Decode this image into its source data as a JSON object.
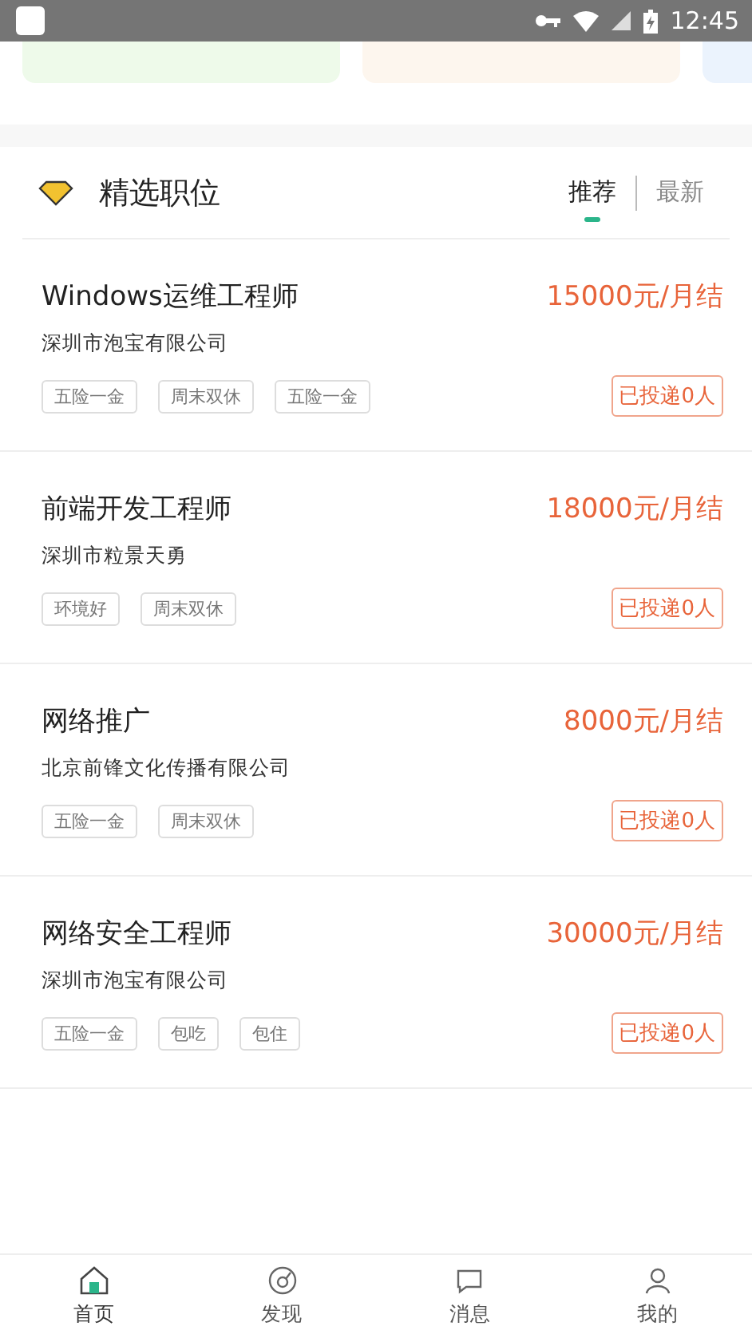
{
  "status_bar": {
    "time": "12:45"
  },
  "section": {
    "title": "精选职位",
    "tabs": [
      {
        "label": "推荐",
        "selected": true
      },
      {
        "label": "最新",
        "selected": false
      }
    ]
  },
  "jobs": [
    {
      "title": "Windows运维工程师",
      "salary": "15000元/月结",
      "company": "深圳市泡宝有限公司",
      "tags": [
        "五险一金",
        "周末双休",
        "五险一金"
      ],
      "applied": "已投递0人"
    },
    {
      "title": "前端开发工程师",
      "salary": "18000元/月结",
      "company": "深圳市粒景天勇",
      "tags": [
        "环境好",
        "周末双休"
      ],
      "applied": "已投递0人"
    },
    {
      "title": "网络推广",
      "salary": "8000元/月结",
      "company": "北京前锋文化传播有限公司",
      "tags": [
        "五险一金",
        "周末双休"
      ],
      "applied": "已投递0人"
    },
    {
      "title": "网络安全工程师",
      "salary": "30000元/月结",
      "company": "深圳市泡宝有限公司",
      "tags": [
        "五险一金",
        "包吃",
        "包住"
      ],
      "applied": "已投递0人"
    }
  ],
  "bottom_nav": [
    {
      "label": "首页",
      "kind": "home",
      "selected": true
    },
    {
      "label": "发现",
      "kind": "discover",
      "selected": false
    },
    {
      "label": "消息",
      "kind": "message",
      "selected": false
    },
    {
      "label": "我的",
      "kind": "profile",
      "selected": false
    }
  ]
}
